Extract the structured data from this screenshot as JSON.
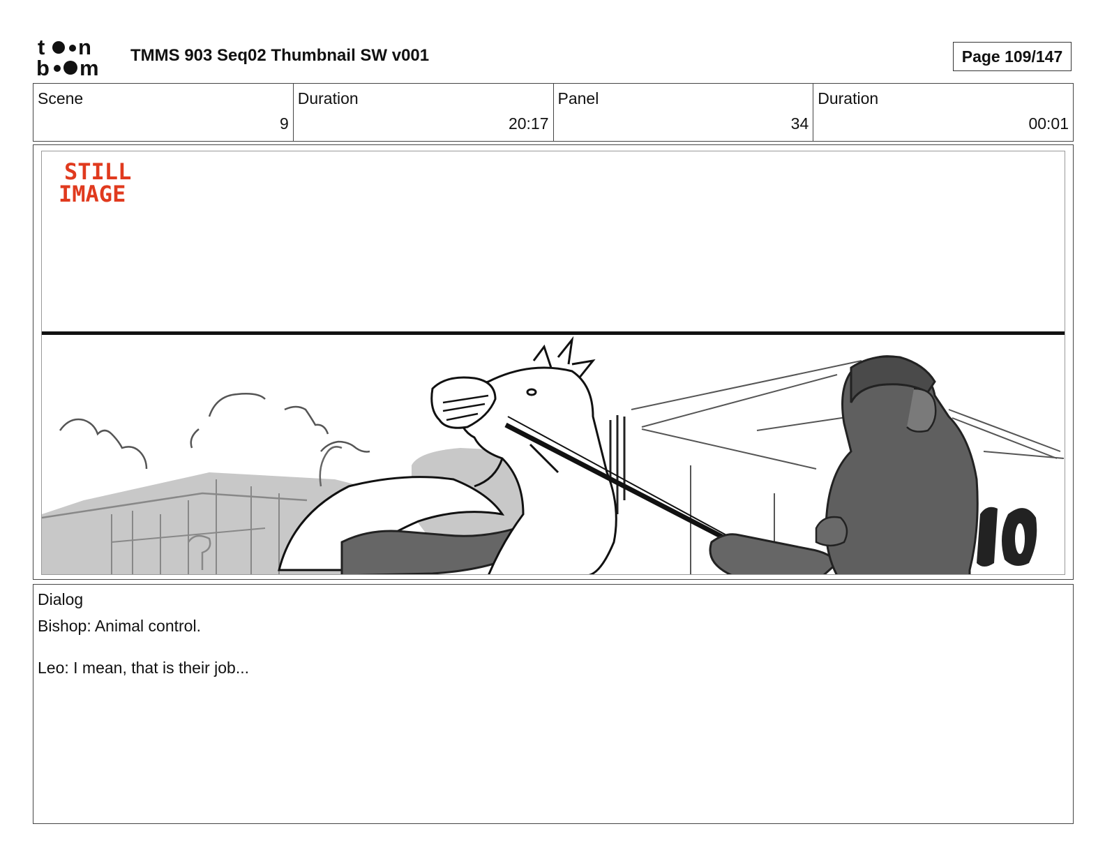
{
  "header": {
    "logo_text": "toon boom",
    "title": "TMMS 903 Seq02 Thumbnail SW v001",
    "page_indicator": "Page 109/147"
  },
  "info": {
    "scene_label": "Scene",
    "scene_value": "9",
    "scene_duration_label": "Duration",
    "scene_duration_value": "20:17",
    "panel_label": "Panel",
    "panel_value": "34",
    "panel_duration_label": "Duration",
    "panel_duration_value": "00:01"
  },
  "panel": {
    "still_line1": "STILL",
    "still_line2": "IMAGE",
    "still_color": "#e03a1e"
  },
  "dialog": {
    "label": "Dialog",
    "lines": [
      "Bishop: Animal control.",
      "Leo: I mean, that is their job..."
    ]
  }
}
